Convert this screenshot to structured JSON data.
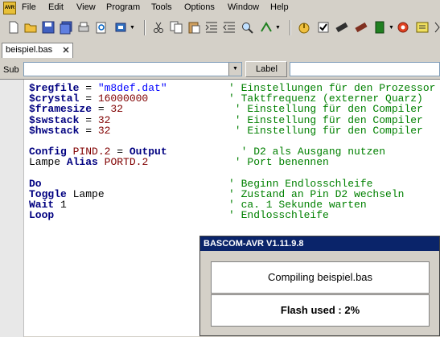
{
  "app_icon_text": "AVR",
  "menu": [
    "File",
    "Edit",
    "View",
    "Program",
    "Tools",
    "Options",
    "Window",
    "Help"
  ],
  "tab": {
    "label": "beispiel.bas"
  },
  "subrow": {
    "sub_label": "Sub",
    "sub_value": "",
    "label_button": "Label",
    "label_value": ""
  },
  "code": [
    {
      "parts": [
        {
          "t": "$regfile",
          "k": "kw"
        },
        {
          "t": " = ",
          "k": "pl"
        },
        {
          "t": "\"m8def.dat\"",
          "k": "str"
        }
      ],
      "comment": "' Einstellungen für den Prozessor"
    },
    {
      "parts": [
        {
          "t": "$crystal",
          "k": "kw"
        },
        {
          "t": " = ",
          "k": "pl"
        },
        {
          "t": "16000000",
          "k": "num"
        }
      ],
      "comment": "' Taktfrequenz (externer Quarz)"
    },
    {
      "parts": [
        {
          "t": "$framesize",
          "k": "kw"
        },
        {
          "t": " = ",
          "k": "pl"
        },
        {
          "t": "32",
          "k": "num"
        }
      ],
      "comment": " ' Einstellung für den Compiler"
    },
    {
      "parts": [
        {
          "t": "$swstack",
          "k": "kw"
        },
        {
          "t": " = ",
          "k": "pl"
        },
        {
          "t": "32",
          "k": "num"
        }
      ],
      "comment": " ' Einstellung für den Compiler"
    },
    {
      "parts": [
        {
          "t": "$hwstack",
          "k": "kw"
        },
        {
          "t": " = ",
          "k": "pl"
        },
        {
          "t": "32",
          "k": "num"
        }
      ],
      "comment": " ' Einstellung für den Compiler"
    },
    {
      "parts": [],
      "comment": ""
    },
    {
      "parts": [
        {
          "t": "Config",
          "k": "kw"
        },
        {
          "t": " ",
          "k": "pl"
        },
        {
          "t": "PIND.2",
          "k": "num"
        },
        {
          "t": " = ",
          "k": "pl"
        },
        {
          "t": "Output",
          "k": "kw"
        }
      ],
      "comment": "  ' D2 als Ausgang nutzen"
    },
    {
      "parts": [
        {
          "t": "Lampe ",
          "k": "pl"
        },
        {
          "t": "Alias",
          "k": "kw"
        },
        {
          "t": " ",
          "k": "pl"
        },
        {
          "t": "PORTD.2",
          "k": "num"
        }
      ],
      "comment": " ' Port benennen"
    },
    {
      "parts": [],
      "comment": ""
    },
    {
      "parts": [
        {
          "t": "Do",
          "k": "kw"
        }
      ],
      "comment": "' Beginn Endlosschleife"
    },
    {
      "parts": [
        {
          "t": "Toggle",
          "k": "kw"
        },
        {
          "t": " Lampe",
          "k": "pl"
        }
      ],
      "comment": "' Zustand an Pin D2 wechseln"
    },
    {
      "parts": [
        {
          "t": "Wait",
          "k": "kw"
        },
        {
          "t": " 1",
          "k": "pl"
        }
      ],
      "comment": "' ca. 1 Sekunde warten"
    },
    {
      "parts": [
        {
          "t": "Loop",
          "k": "kw"
        }
      ],
      "comment": "' Endlosschleife"
    }
  ],
  "dialog": {
    "title": "BASCOM-AVR V1.11.9.8",
    "compiling": "Compiling  beispiel.bas",
    "flash": "Flash used : 2%"
  },
  "colors": {
    "keyword": "#000080",
    "string": "#0000ff",
    "number": "#800000",
    "comment": "#008000",
    "titlebar": "#0a246a"
  }
}
